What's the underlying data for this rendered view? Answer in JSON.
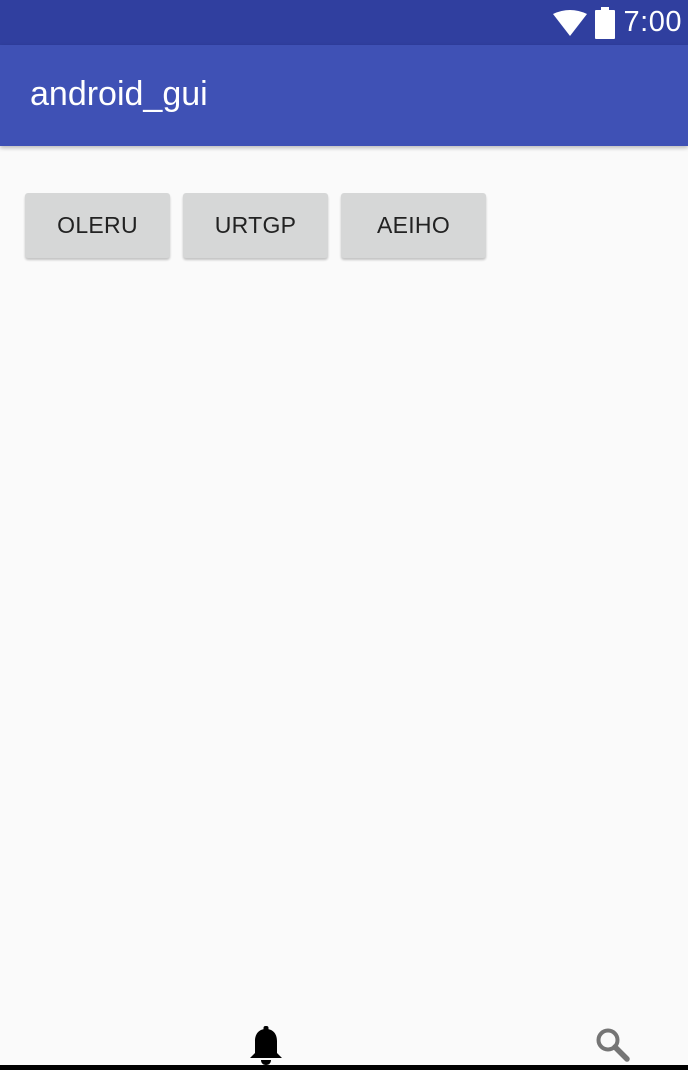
{
  "status_bar": {
    "time": "7:00",
    "icons": [
      "wifi-icon",
      "battery-icon"
    ],
    "background": "#303f9f"
  },
  "app_bar": {
    "title": "android_gui",
    "background": "#3f51b5"
  },
  "buttons": [
    {
      "label": "OLERU"
    },
    {
      "label": "URTGP"
    },
    {
      "label": "AEIHO"
    }
  ],
  "bottom_bar": {
    "icons": [
      "bell-icon",
      "search-icon"
    ]
  }
}
